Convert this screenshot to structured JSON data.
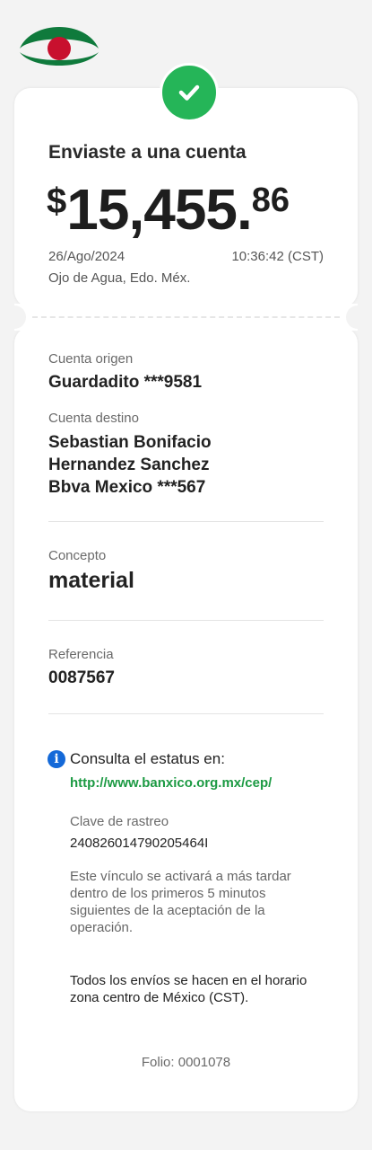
{
  "receipt": {
    "title": "Enviaste a una cuenta",
    "amount": {
      "currency_symbol": "$",
      "integer": "15,455.",
      "cents": "86"
    },
    "date": "26/Ago/2024",
    "time": "10:36:42 (CST)",
    "location": "Ojo de Agua, Edo. Méx."
  },
  "details": {
    "origin_label": "Cuenta origen",
    "origin_value": "Guardadito ***9581",
    "dest_label": "Cuenta destino",
    "dest_name_line1": "Sebastian Bonifacio",
    "dest_name_line2": "Hernandez Sanchez",
    "dest_bank": "Bbva Mexico ***567",
    "concept_label": "Concepto",
    "concept_value": "material",
    "ref_label": "Referencia",
    "ref_value": "0087567"
  },
  "status": {
    "consulta_text": "Consulta el estatus en:",
    "link_text": "http://www.banxico.org.mx/cep/",
    "clave_label": "Clave de rastreo",
    "clave_value": "240826014790205464I",
    "activation_note": "Este vínculo se activará a más tardar dentro de los primeros 5 minutos siguientes de la aceptación de la operación.",
    "timezone_note": "Todos los envíos se hacen en el horario zona centro de México (CST).",
    "folio": "Folio: 0001078"
  },
  "colors": {
    "success_green": "#25b558",
    "link_green": "#1c9a43",
    "info_blue": "#1469d8",
    "logo_green": "#0f7a3c",
    "logo_red": "#c8102e"
  },
  "icons": [
    "bank-logo",
    "check-icon",
    "info-icon"
  ]
}
